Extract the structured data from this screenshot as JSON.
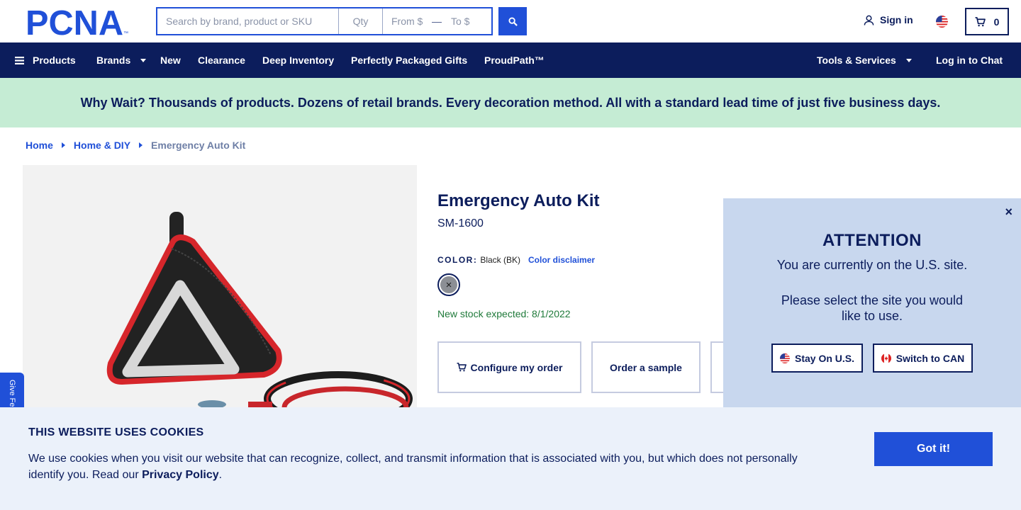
{
  "header": {
    "logo_text": "PCNA",
    "logo_mark": "™",
    "search": {
      "placeholder": "Search by brand, product or SKU",
      "qty_placeholder": "Qty",
      "from_placeholder": "From $",
      "dash": "—",
      "to_placeholder": "To $"
    },
    "signin_label": "Sign in",
    "cart_count": "0"
  },
  "nav": {
    "products": "Products",
    "brands": "Brands",
    "new": "New",
    "clearance": "Clearance",
    "deep_inventory": "Deep Inventory",
    "gifts": "Perfectly Packaged Gifts",
    "proudpath": "ProudPath™",
    "tools": "Tools & Services",
    "chat": "Log in to Chat"
  },
  "banner": {
    "text": "Why Wait? Thousands of products. Dozens of retail brands. Every decoration method. All with a standard lead time of just five business days."
  },
  "breadcrumb": {
    "home": "Home",
    "category": "Home & DIY",
    "current": "Emergency Auto Kit"
  },
  "product": {
    "title": "Emergency Auto Kit",
    "sku": "SM-1600",
    "color_label": "COLOR:",
    "color_value": "Black (BK)",
    "color_disclaimer": "Color disclaimer",
    "swatch_mark": "×",
    "stock": "New stock expected: 8/1/2022",
    "actions": {
      "configure": "Configure my order",
      "sample": "Order a sample"
    }
  },
  "feedback": {
    "label": "Give Feedback"
  },
  "attention": {
    "close": "×",
    "heading": "ATTENTION",
    "line1": "You are currently on the U.S. site.",
    "line2": "Please select the site you would like to use.",
    "stay": "Stay On U.S.",
    "switch": "Switch to CAN"
  },
  "cookie": {
    "title": "THIS WEBSITE USES COOKIES",
    "text": "We use cookies when you visit our website that can recognize, collect, and transmit information that is associated with you, but which does not personally identify you. Read our",
    "privacy": "Privacy Policy",
    "period": ".",
    "button": "Got it!"
  },
  "colors": {
    "navy": "#0c1d5c",
    "blue": "#2050d8",
    "banner_green": "#c5ecd4",
    "dialog": "#c8d7ee",
    "cookie_bg": "#ebf1fa",
    "stock_green": "#1f7a3a"
  }
}
